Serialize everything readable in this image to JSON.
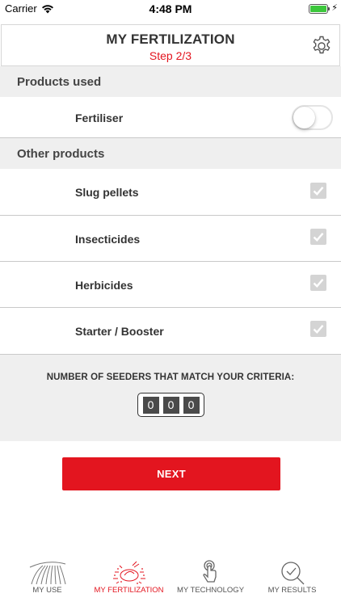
{
  "status_bar": {
    "carrier": "Carrier",
    "time": "4:48 PM",
    "battery_color": "#3cc73c"
  },
  "header": {
    "title": "MY FERTILIZATION",
    "step": "Step 2/3",
    "settings_icon": "gear-icon"
  },
  "sections": {
    "products_used": {
      "title": "Products used",
      "items": [
        {
          "label": "Fertiliser",
          "control": "toggle",
          "on": false
        }
      ]
    },
    "other_products": {
      "title": "Other products",
      "items": [
        {
          "label": "Slug pellets",
          "control": "checkbox",
          "checked": true
        },
        {
          "label": "Insecticides",
          "control": "checkbox",
          "checked": true
        },
        {
          "label": "Herbicides",
          "control": "checkbox",
          "checked": true
        },
        {
          "label": "Starter / Booster",
          "control": "checkbox",
          "checked": true
        }
      ]
    }
  },
  "counter": {
    "label": "NUMBER OF SEEDERS THAT MATCH YOUR CRITERIA:",
    "digits": [
      "0",
      "0",
      "0"
    ]
  },
  "next_button": {
    "label": "NEXT"
  },
  "tabs": [
    {
      "label": "MY USE",
      "icon": "field-icon",
      "active": false
    },
    {
      "label": "MY FERTILIZATION",
      "icon": "fertilization-icon",
      "active": true
    },
    {
      "label": "MY TECHNOLOGY",
      "icon": "touch-icon",
      "active": false
    },
    {
      "label": "MY RESULTS",
      "icon": "search-results-icon",
      "active": false
    }
  ],
  "colors": {
    "accent": "#e3151f",
    "section_bg": "#efefef",
    "text": "#333333"
  }
}
